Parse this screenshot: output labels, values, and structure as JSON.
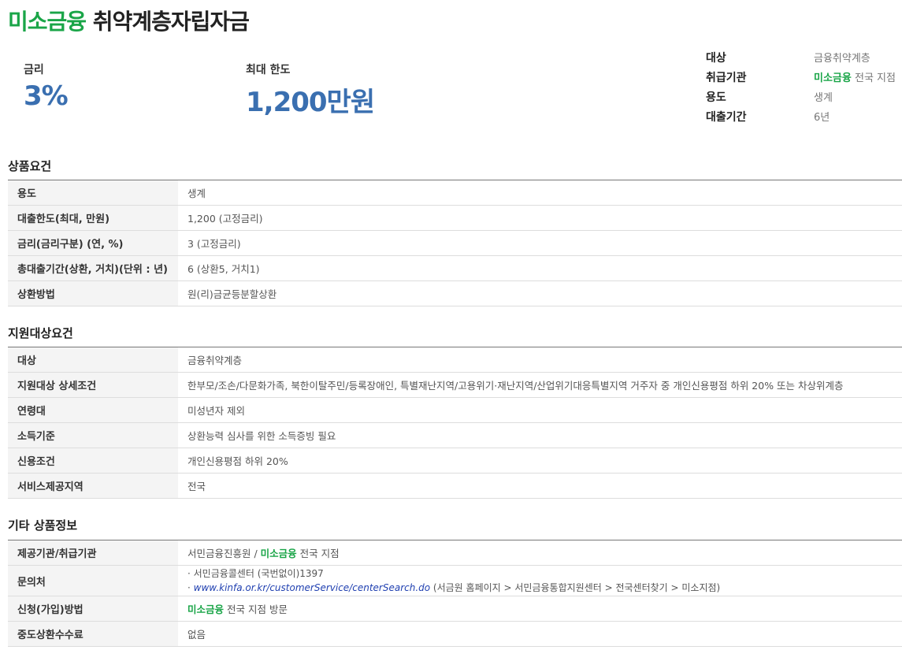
{
  "title": {
    "brand": "미소금융",
    "name": "취약계층자립자금"
  },
  "metrics": {
    "rate_label": "금리",
    "rate_value": "3%",
    "limit_label": "최대 한도",
    "limit_value": "1,200만원"
  },
  "summary": {
    "rows": [
      {
        "key": "대상",
        "value": "금융취약계층"
      },
      {
        "key": "취급기관",
        "brand": "미소금융",
        "value": "전국 지점"
      },
      {
        "key": "용도",
        "value": "생계"
      },
      {
        "key": "대출기간",
        "value": "6년"
      }
    ]
  },
  "product": {
    "title": "상품요건",
    "rows": [
      {
        "key": "용도",
        "value": "생계"
      },
      {
        "key": "대출한도(최대, 만원)",
        "value": "1,200 (고정금리)"
      },
      {
        "key": "금리(금리구분) (연, %)",
        "value": "3 (고정금리)"
      },
      {
        "key": "총대출기간(상환, 거치)(단위 : 년)",
        "value": "6 (상환5, 거치1)"
      },
      {
        "key": "상환방법",
        "value": "원(리)금균등분할상환"
      }
    ]
  },
  "eligibility": {
    "title": "지원대상요건",
    "rows": [
      {
        "key": "대상",
        "value": "금융취약계층"
      },
      {
        "key": "지원대상 상세조건",
        "value": "한부모/조손/다문화가족, 북한이탈주민/등록장애인, 특별재난지역/고용위기·재난지역/산업위기대응특별지역 거주자 중 개인신용평점 하위 20% 또는 차상위계층"
      },
      {
        "key": "연령대",
        "value": "미성년자 제외"
      },
      {
        "key": "소득기준",
        "value": "상환능력 심사를 위한 소득증빙 필요"
      },
      {
        "key": "신용조건",
        "value": "개인신용평점 하위 20%"
      },
      {
        "key": "서비스제공지역",
        "value": "전국"
      }
    ]
  },
  "other": {
    "title": "기타 상품정보",
    "provider_key": "제공기관/취급기관",
    "provider_prefix": "서민금융진흥원 /",
    "provider_brand": "미소금융",
    "provider_suffix": "전국 지점",
    "contact_key": "문의처",
    "contact_line1": "· 서민금융콜센터 (국번없이)1397",
    "contact_bullet": "· ",
    "contact_link": "www.kinfa.or.kr/customerService/centerSearch.do",
    "contact_suffix": " (서금원 홈페이지 > 서민금융통합지원센터 > 전국센터찾기 > 미소지점)",
    "apply_key": "신청(가입)방법",
    "apply_brand": "미소금융",
    "apply_suffix": "전국 지점 방문",
    "fee_key": "중도상환수수료",
    "fee_value": "없음"
  }
}
